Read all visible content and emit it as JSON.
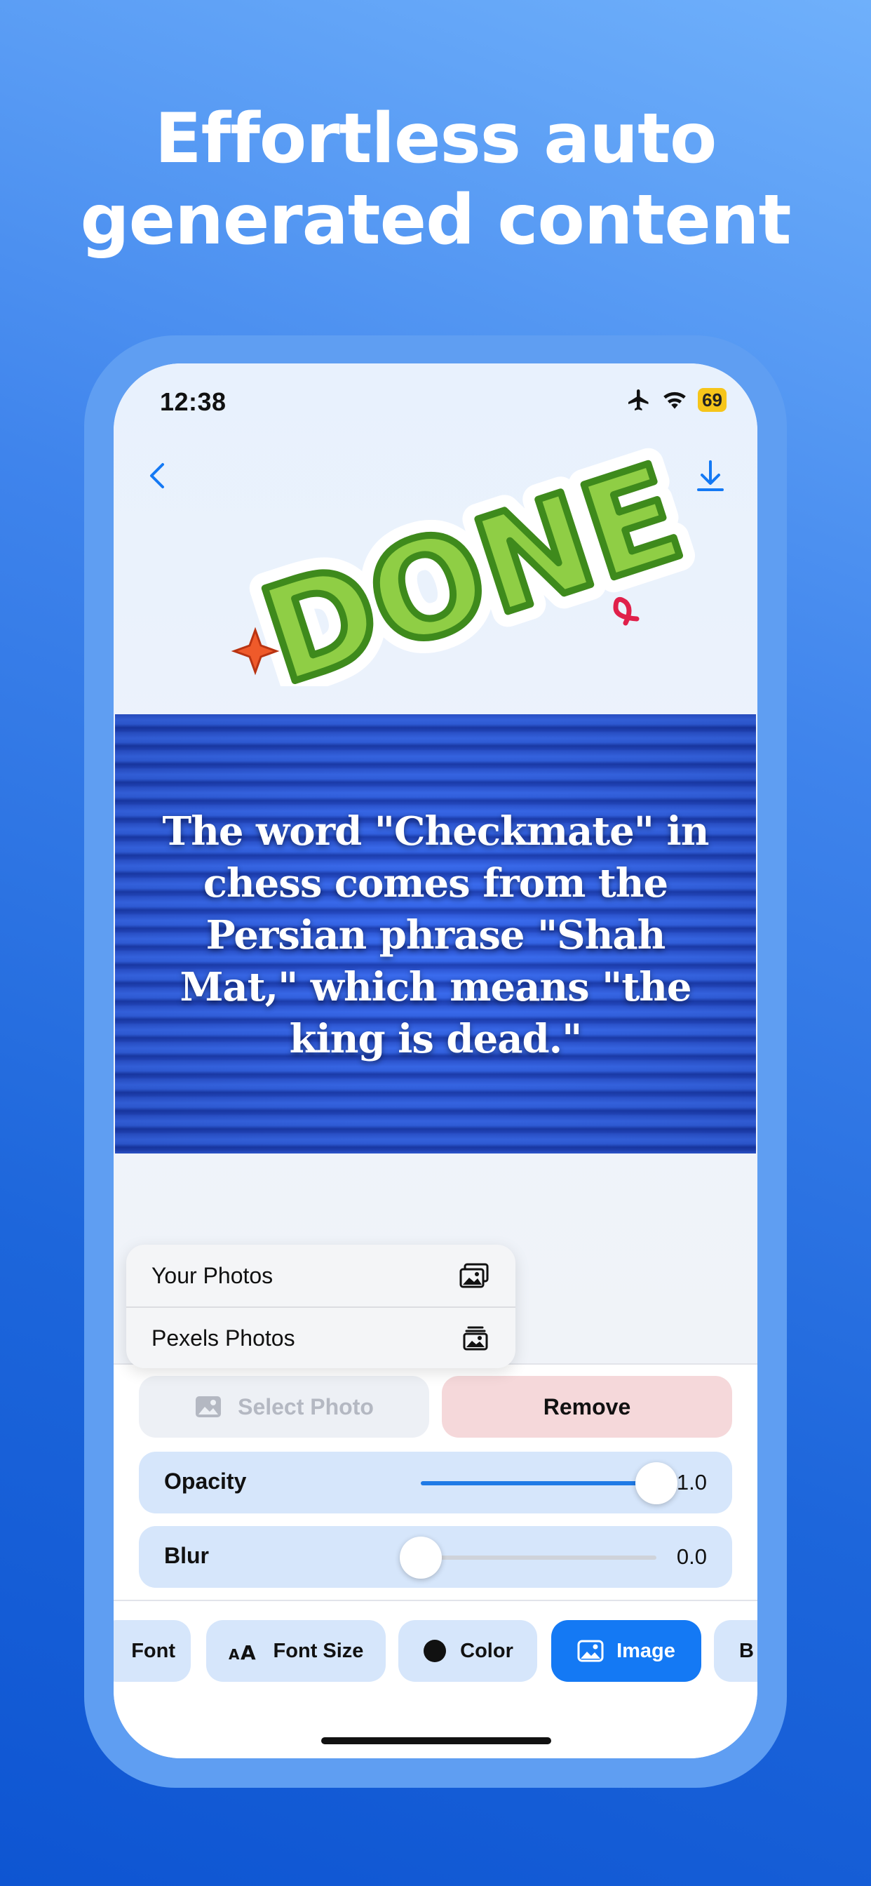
{
  "headline": {
    "line1": "Effortless auto",
    "line2": "generated content"
  },
  "status_bar": {
    "time": "12:38",
    "battery": "69",
    "icons": [
      "airplane-icon",
      "wifi-icon",
      "battery-icon"
    ]
  },
  "nav": {
    "back_icon": "chevron-left-icon",
    "download_icon": "download-icon"
  },
  "sticker": {
    "text": "DONE"
  },
  "quote": {
    "text": "The word \"Checkmate\" in chess comes from the Persian phrase \"Shah Mat,\" which means \"the king is dead.\""
  },
  "photo_menu": {
    "items": [
      {
        "label": "Your Photos",
        "icon": "photos-icon"
      },
      {
        "label": "Pexels Photos",
        "icon": "photo-stack-icon"
      }
    ]
  },
  "image_panel": {
    "select_photo_label": "Select Photo",
    "remove_label": "Remove",
    "opacity": {
      "label": "Opacity",
      "value_text": "1.0",
      "value": 1.0
    },
    "blur": {
      "label": "Blur",
      "value_text": "0.0",
      "value": 0.0
    }
  },
  "toolbar": {
    "tabs": [
      {
        "label": "Font",
        "icon": ""
      },
      {
        "label": "Font Size",
        "icon": "text-size-icon"
      },
      {
        "label": "Color",
        "icon": "color-dot-icon"
      },
      {
        "label": "Image",
        "icon": "image-icon",
        "active": true
      },
      {
        "label": "B",
        "icon": ""
      }
    ]
  },
  "colors": {
    "accent": "#1479f4",
    "chip_background": "#d6e6fb",
    "remove_background": "#f5d8da"
  }
}
